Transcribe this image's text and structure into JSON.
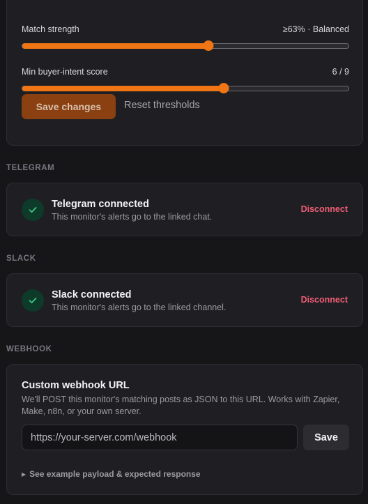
{
  "thresholds": {
    "match_strength": {
      "label": "Match strength",
      "value_text": "≥63% · Balanced",
      "fraction": 0.57
    },
    "buyer_intent": {
      "label": "Min buyer-intent score",
      "value_text": "6 / 9",
      "fraction": 0.617
    },
    "save_label": "Save changes",
    "reset_label": "Reset thresholds"
  },
  "telegram": {
    "section_label": "TELEGRAM",
    "title": "Telegram connected",
    "subtitle": "This monitor's alerts go to the linked chat.",
    "action_label": "Disconnect"
  },
  "slack": {
    "section_label": "SLACK",
    "title": "Slack connected",
    "subtitle": "This monitor's alerts go to the linked channel.",
    "action_label": "Disconnect"
  },
  "webhook": {
    "section_label": "WEBHOOK",
    "title": "Custom webhook URL",
    "description": "We'll POST this monitor's matching posts as JSON to this URL. Works with Zapier, Make, n8n, or your own server.",
    "input_value": "",
    "input_placeholder": "https://your-server.com/webhook",
    "save_label": "Save",
    "example_label": "See example payload & expected response"
  },
  "colors": {
    "accent": "#f07514",
    "danger": "#ef5d76",
    "success_bg": "#0e3a2a",
    "success_check": "#3fd68f"
  },
  "icons": {
    "check": "check-icon",
    "disclosure": "triangle-right-icon"
  }
}
